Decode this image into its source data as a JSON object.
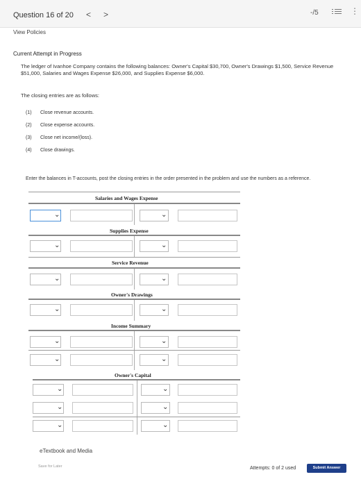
{
  "header": {
    "question_label": "Question 16 of 20",
    "prev_glyph": "<",
    "next_glyph": ">",
    "score": "-/5",
    "list_icon": "list-icon",
    "more_icon": "more-vertical-icon",
    "more_glyph": "⋮"
  },
  "view_policies": "View Policies",
  "attempt_status": "Current Attempt in Progress",
  "problem_text": "The ledger of Ivanhoe Company contains the following balances: Owner's Capital $30,700, Owner's Drawings $1,500, Service Revenue $51,000, Salaries and Wages Expense $26,000, and Supplies Expense $6,000.",
  "closing_intro": "The closing entries are as follows:",
  "steps": [
    {
      "num": "(1)",
      "text": "Close revenue accounts."
    },
    {
      "num": "(2)",
      "text": "Close expense accounts."
    },
    {
      "num": "(3)",
      "text": "Close net income/(loss)."
    },
    {
      "num": "(4)",
      "text": "Close drawings."
    }
  ],
  "instructions": "Enter the balances in T-accounts, post the closing entries in the order presented in the problem and use the numbers as a reference.",
  "accounts": {
    "salaries_wages_expense": "Salaries and Wages Expense",
    "supplies_expense": "Supplies Expense",
    "service_revenue": "Service Revenue",
    "owners_drawings": "Owner's Drawings",
    "income_summary": "Income Summary",
    "owners_capital": "Owner's Capital"
  },
  "chevron": "⌄",
  "etextbook": "eTextbook and Media",
  "save_for_later": "Save for Later",
  "attempts_text": "Attempts: 0 of 2 used",
  "submit_label": "Submit Answer",
  "colors": {
    "submit_bg": "#1e3f8a",
    "focus_border": "#4a90d9"
  }
}
